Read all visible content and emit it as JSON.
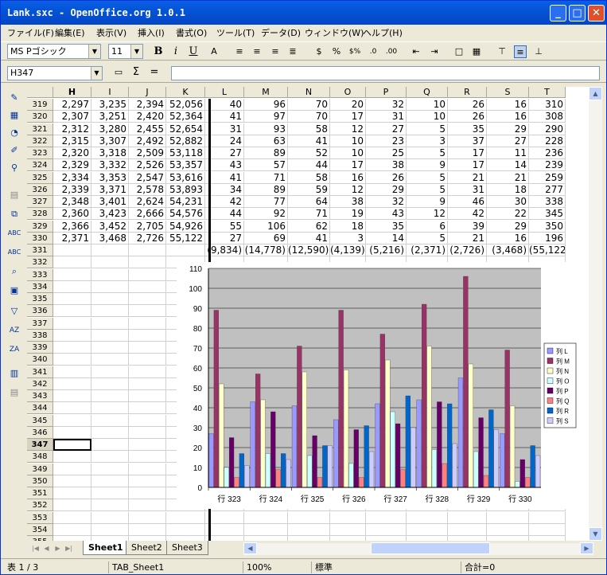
{
  "window": {
    "title": "Lank.sxc - OpenOffice.org 1.0.1",
    "min": "_",
    "max": "□",
    "close": "✕"
  },
  "menu": [
    "ファイル(F)",
    "編集(E)",
    "表示(V)",
    "挿入(I)",
    "書式(O)",
    "ツール(T)",
    "データ(D)",
    "ウィンドウ(W)",
    "ヘルプ(H)"
  ],
  "toolbar": {
    "font_name": "MS Pゴシック",
    "font_size": "11",
    "bold": "B",
    "italic": "i",
    "underline": "U"
  },
  "formula": {
    "cell_ref": "H347",
    "sigma": "Σ",
    "equals": "="
  },
  "columns": [
    "H",
    "I",
    "J",
    "K",
    "L",
    "M",
    "N",
    "O",
    "P",
    "Q",
    "R",
    "S",
    "T"
  ],
  "rows": [
    {
      "n": "319",
      "v": [
        "2,297",
        "3,235",
        "2,394",
        "52,056",
        "40",
        "96",
        "70",
        "20",
        "32",
        "10",
        "26",
        "16",
        "310"
      ]
    },
    {
      "n": "320",
      "v": [
        "2,307",
        "3,251",
        "2,420",
        "52,364",
        "41",
        "97",
        "70",
        "17",
        "31",
        "10",
        "26",
        "16",
        "308"
      ]
    },
    {
      "n": "321",
      "v": [
        "2,312",
        "3,280",
        "2,455",
        "52,654",
        "31",
        "93",
        "58",
        "12",
        "27",
        "5",
        "35",
        "29",
        "290"
      ]
    },
    {
      "n": "322",
      "v": [
        "2,315",
        "3,307",
        "2,492",
        "52,882",
        "24",
        "63",
        "41",
        "10",
        "23",
        "3",
        "37",
        "27",
        "228"
      ]
    },
    {
      "n": "323",
      "v": [
        "2,320",
        "3,318",
        "2,509",
        "53,118",
        "27",
        "89",
        "52",
        "10",
        "25",
        "5",
        "17",
        "11",
        "236"
      ]
    },
    {
      "n": "324",
      "v": [
        "2,329",
        "3,332",
        "2,526",
        "53,357",
        "43",
        "57",
        "44",
        "17",
        "38",
        "9",
        "17",
        "14",
        "239"
      ]
    },
    {
      "n": "325",
      "v": [
        "2,334",
        "3,353",
        "2,547",
        "53,616",
        "41",
        "71",
        "58",
        "16",
        "26",
        "5",
        "21",
        "21",
        "259"
      ]
    },
    {
      "n": "326",
      "v": [
        "2,339",
        "3,371",
        "2,578",
        "53,893",
        "34",
        "89",
        "59",
        "12",
        "29",
        "5",
        "31",
        "18",
        "277"
      ]
    },
    {
      "n": "327",
      "v": [
        "2,348",
        "3,401",
        "2,624",
        "54,231",
        "42",
        "77",
        "64",
        "38",
        "32",
        "9",
        "46",
        "30",
        "338"
      ]
    },
    {
      "n": "328",
      "v": [
        "2,360",
        "3,423",
        "2,666",
        "54,576",
        "44",
        "92",
        "71",
        "19",
        "43",
        "12",
        "42",
        "22",
        "345"
      ]
    },
    {
      "n": "329",
      "v": [
        "2,366",
        "3,452",
        "2,705",
        "54,926",
        "55",
        "106",
        "62",
        "18",
        "35",
        "6",
        "39",
        "29",
        "350"
      ]
    },
    {
      "n": "330",
      "v": [
        "2,371",
        "3,468",
        "2,726",
        "55,122",
        "27",
        "69",
        "41",
        "3",
        "14",
        "5",
        "21",
        "16",
        "196"
      ]
    },
    {
      "n": "331",
      "v": [
        "",
        "",
        "",
        "",
        "(9,834)",
        "(14,778)",
        "(12,590)",
        "(4,139)",
        "(5,216)",
        "(2,371)",
        "(2,726)",
        "(3,468)",
        "(55,122)"
      ]
    },
    {
      "n": "332",
      "v": []
    },
    {
      "n": "333",
      "v": []
    },
    {
      "n": "334",
      "v": []
    },
    {
      "n": "335",
      "v": []
    },
    {
      "n": "336",
      "v": []
    },
    {
      "n": "337",
      "v": []
    },
    {
      "n": "338",
      "v": []
    },
    {
      "n": "339",
      "v": []
    },
    {
      "n": "340",
      "v": []
    },
    {
      "n": "341",
      "v": []
    },
    {
      "n": "342",
      "v": []
    },
    {
      "n": "343",
      "v": []
    },
    {
      "n": "344",
      "v": []
    },
    {
      "n": "345",
      "v": []
    },
    {
      "n": "346",
      "v": []
    },
    {
      "n": "347",
      "v": []
    },
    {
      "n": "348",
      "v": []
    },
    {
      "n": "349",
      "v": []
    },
    {
      "n": "350",
      "v": []
    },
    {
      "n": "351",
      "v": []
    },
    {
      "n": "352",
      "v": []
    },
    {
      "n": "353",
      "v": []
    },
    {
      "n": "354",
      "v": []
    },
    {
      "n": "355",
      "v": []
    }
  ],
  "selected_row": "347",
  "sheets": [
    "Sheet1",
    "Sheet2",
    "Sheet3"
  ],
  "active_sheet": "Sheet1",
  "status": {
    "page": "表 1 / 3",
    "sheet": "TAB_Sheet1",
    "zoom": "100%",
    "mode": "標準",
    "sum": "合計=0"
  },
  "chart_data": {
    "type": "bar",
    "categories": [
      "行 323",
      "行 324",
      "行 325",
      "行 326",
      "行 327",
      "行 328",
      "行 329",
      "行 330"
    ],
    "ylim": [
      0,
      110
    ],
    "yticks": [
      "0",
      "10",
      "20",
      "30",
      "40",
      "50",
      "60",
      "70",
      "80",
      "90",
      "100",
      "110"
    ],
    "series": [
      {
        "name": "列 L",
        "color": "#9999ff",
        "values": [
          27,
          43,
          41,
          34,
          42,
          44,
          55,
          27
        ]
      },
      {
        "name": "列 M",
        "color": "#993366",
        "values": [
          89,
          57,
          71,
          89,
          77,
          92,
          106,
          69
        ]
      },
      {
        "name": "列 N",
        "color": "#ffffcc",
        "values": [
          52,
          44,
          58,
          59,
          64,
          71,
          62,
          41
        ]
      },
      {
        "name": "列 O",
        "color": "#ccffff",
        "values": [
          10,
          17,
          16,
          12,
          38,
          19,
          18,
          3
        ]
      },
      {
        "name": "列 P",
        "color": "#660066",
        "values": [
          25,
          38,
          26,
          29,
          32,
          43,
          35,
          14
        ]
      },
      {
        "name": "列 Q",
        "color": "#ff8080",
        "values": [
          5,
          9,
          5,
          5,
          9,
          12,
          6,
          5
        ]
      },
      {
        "name": "列 R",
        "color": "#0066cc",
        "values": [
          17,
          17,
          21,
          31,
          46,
          42,
          39,
          21
        ]
      },
      {
        "name": "列 S",
        "color": "#ccccff",
        "values": [
          11,
          14,
          21,
          18,
          30,
          22,
          29,
          16
        ]
      }
    ]
  }
}
